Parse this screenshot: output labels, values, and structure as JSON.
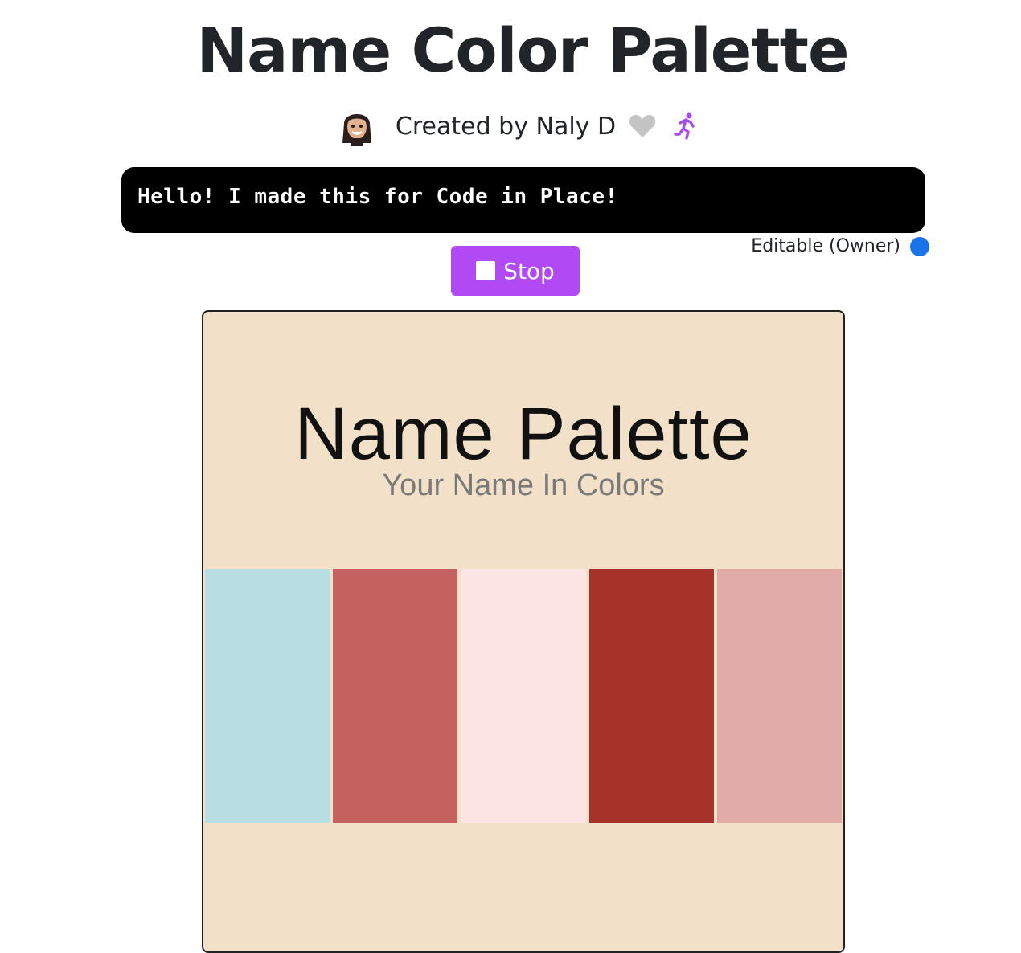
{
  "page": {
    "title": "Name Color Palette",
    "author_text": "Created by Naly D"
  },
  "console": {
    "output": "Hello! I made this for Code in Place!"
  },
  "status": {
    "editable_label": "Editable (Owner)",
    "dot_color": "#1a73e8"
  },
  "controls": {
    "stop_label": "Stop",
    "stop_color": "#b14af5"
  },
  "canvas": {
    "title": "Name Palette",
    "subtitle": "Your Name In Colors",
    "background": "#f2e1c8",
    "swatches": [
      "#b7dfe3",
      "#c5625f",
      "#fbe4e2",
      "#a63229",
      "#e0aaa7"
    ]
  },
  "icons": [
    "avatar",
    "heart-icon",
    "run-icon",
    "stop-icon"
  ]
}
